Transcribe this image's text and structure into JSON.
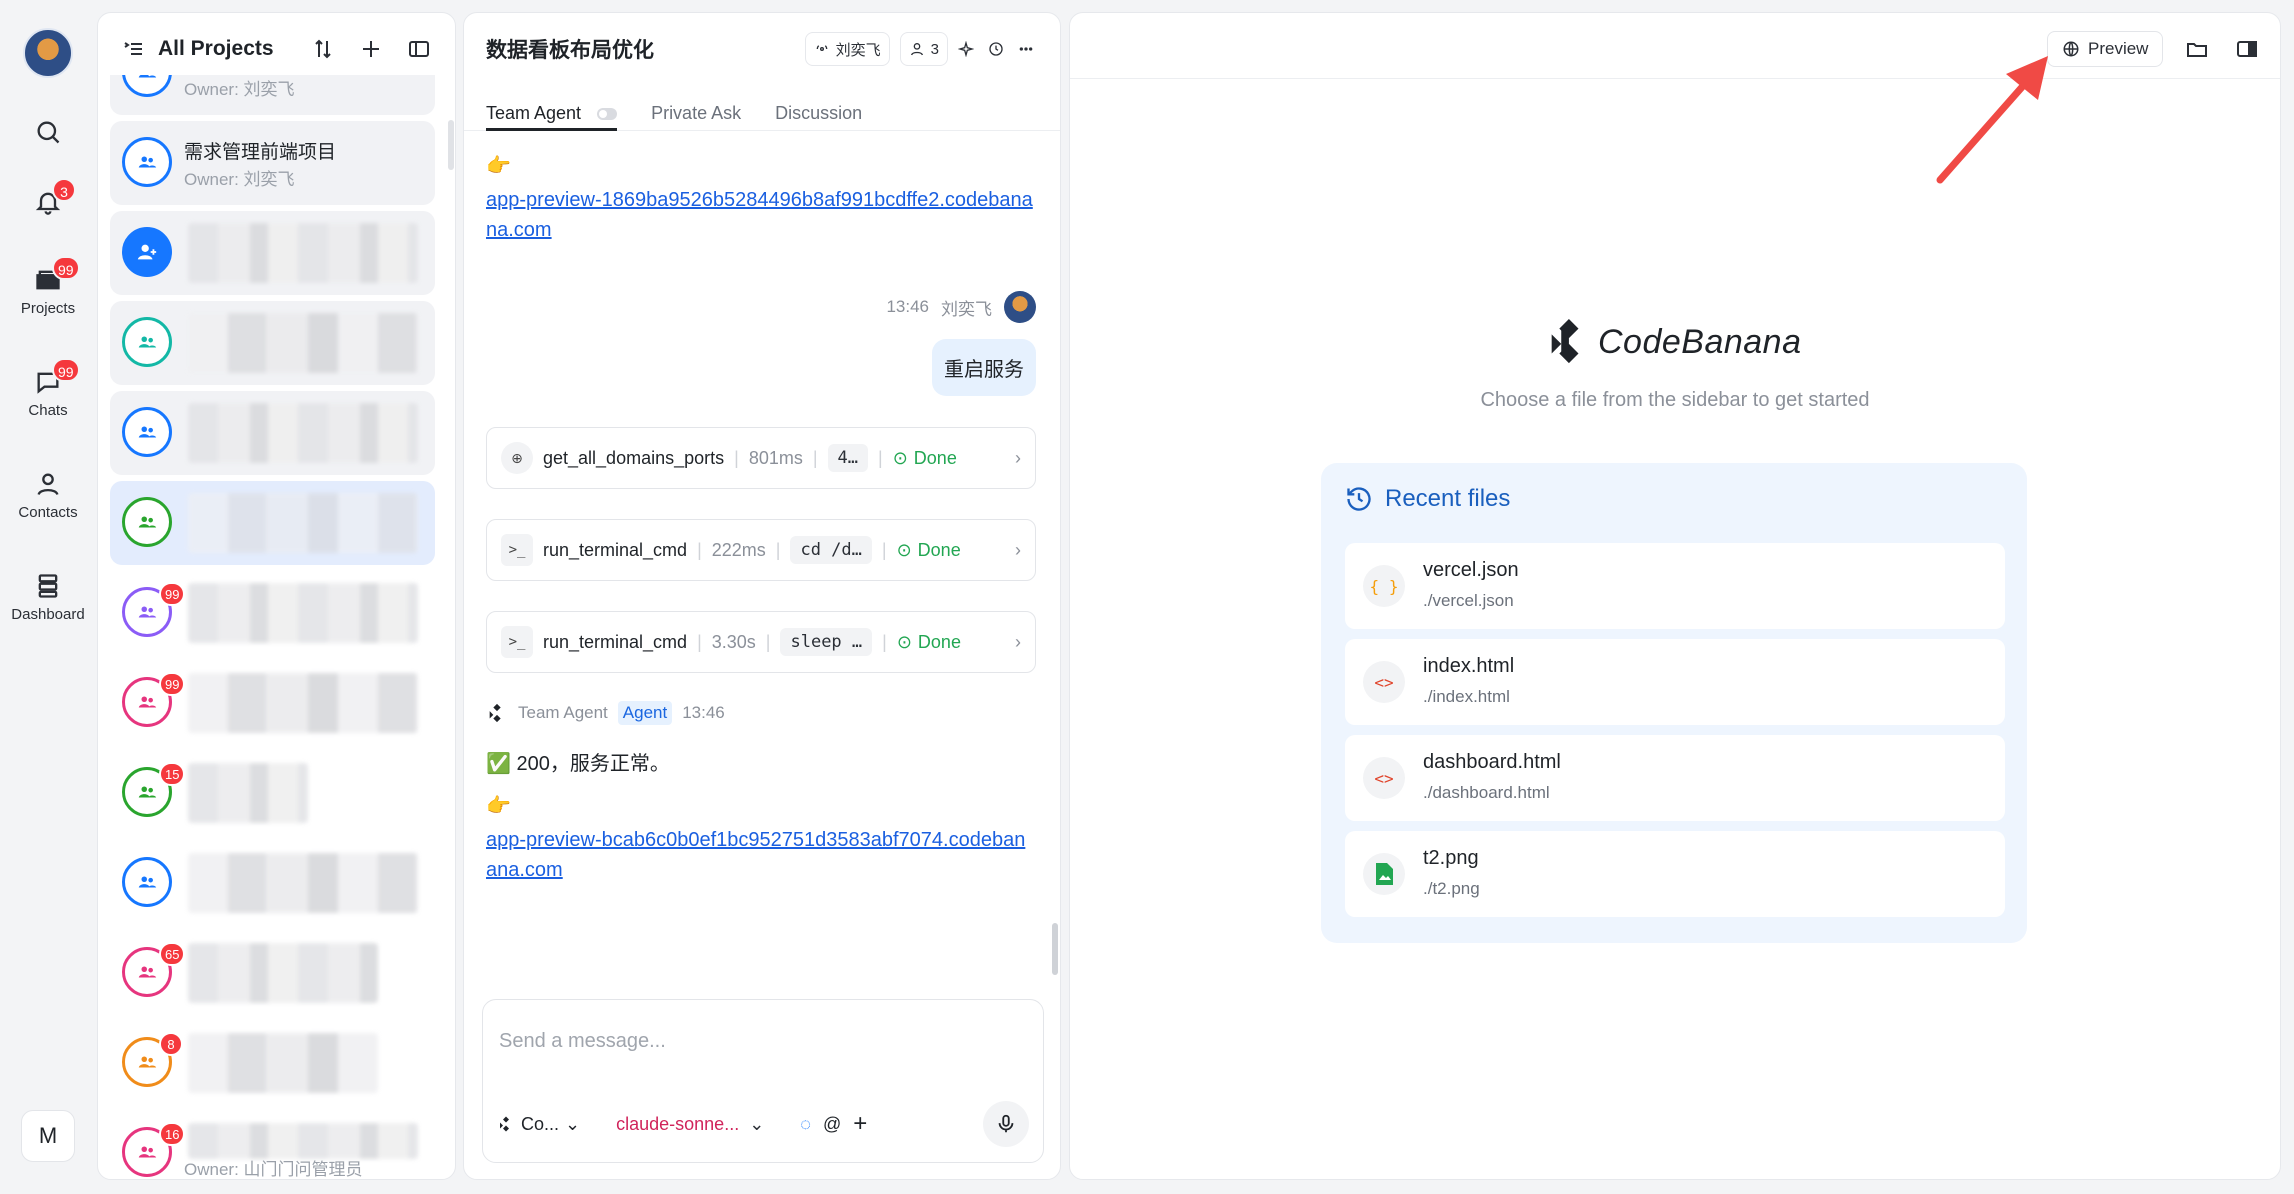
{
  "rail": {
    "items": [
      {
        "name": "search",
        "label": ""
      },
      {
        "name": "notifications",
        "label": "",
        "badge": "3"
      },
      {
        "name": "projects",
        "label": "Projects",
        "badge": "99"
      },
      {
        "name": "chats",
        "label": "Chats",
        "badge": "99"
      },
      {
        "name": "contacts",
        "label": "Contacts"
      },
      {
        "name": "dashboard",
        "label": "Dashboard"
      }
    ],
    "workspace_initial": "M"
  },
  "projects": {
    "title": "All Projects",
    "items": [
      {
        "name": "",
        "owner": "Owner: 刘奕飞",
        "color": "#1677ff"
      },
      {
        "name": "需求管理前端项目",
        "owner": "Owner: 刘奕飞",
        "color": "#1677ff"
      },
      {
        "name": "",
        "owner": "",
        "color": "#1677ff"
      },
      {
        "name": "",
        "owner": "",
        "color": "#13b8a6"
      },
      {
        "name": "",
        "owner": "",
        "color": "#1677ff"
      },
      {
        "name": "",
        "owner": "",
        "color": "#2aa52e"
      },
      {
        "name": "",
        "owner": "",
        "color": "#8b5cf6",
        "badge": "99"
      },
      {
        "name": "",
        "owner": "",
        "color": "#e6357e",
        "badge": "99"
      },
      {
        "name": "",
        "owner": "",
        "color": "#2aa52e",
        "badge": "15"
      },
      {
        "name": "",
        "owner": "",
        "color": "#1677ff"
      },
      {
        "name": "",
        "owner": "",
        "color": "#e6357e",
        "badge": "65"
      },
      {
        "name": "",
        "owner": "",
        "color": "#f08c1a",
        "badge": "8"
      },
      {
        "name": "",
        "owner": "Owner: 山门门问管理员",
        "color": "#e6357e",
        "badge": "16"
      }
    ]
  },
  "chat": {
    "title": "数据看板布局优化",
    "owner_pill": "刘奕飞",
    "members_count": "3",
    "tabs": [
      "Team Agent",
      "Private Ask",
      "Discussion"
    ],
    "messages": {
      "link1": "app-preview-1869ba9526b5284496b8af991bcdffe2.codebanana.com",
      "user_time": "13:46",
      "user_name": "刘奕飞",
      "user_text": "重启服务",
      "agent_name": "Team Agent",
      "agent_tag": "Agent",
      "agent_time": "13:46",
      "agent_text": "✅ 200，服务正常。",
      "link2": "app-preview-bcab6c0b0ef1bc952751d3583abf7074.codebanana.com"
    },
    "tools": [
      {
        "name": "get_all_domains_ports",
        "time": "801ms",
        "arg": "4…",
        "status": "Done",
        "icon": "globe"
      },
      {
        "name": "run_terminal_cmd",
        "time": "222ms",
        "arg": "cd /d…",
        "status": "Done",
        "icon": "terminal"
      },
      {
        "name": "run_terminal_cmd",
        "time": "3.30s",
        "arg": "sleep …",
        "status": "Done",
        "icon": "terminal"
      }
    ],
    "composer": {
      "placeholder": "Send a message...",
      "agent_select": "Co...",
      "model_select": "claude-sonne..."
    }
  },
  "viewer": {
    "preview_label": "Preview",
    "brand": "CodeBanana",
    "hint": "Choose a file from the sidebar to get started",
    "recent_title": "Recent files",
    "files": [
      {
        "name": "vercel.json",
        "path": "./vercel.json",
        "icon": "{ }",
        "color": "#f59e0b"
      },
      {
        "name": "index.html",
        "path": "./index.html",
        "icon": "<>",
        "color": "#e0442b"
      },
      {
        "name": "dashboard.html",
        "path": "./dashboard.html",
        "icon": "<>",
        "color": "#e0442b"
      },
      {
        "name": "t2.png",
        "path": "./t2.png",
        "icon": "img",
        "color": "#22a652"
      }
    ]
  }
}
